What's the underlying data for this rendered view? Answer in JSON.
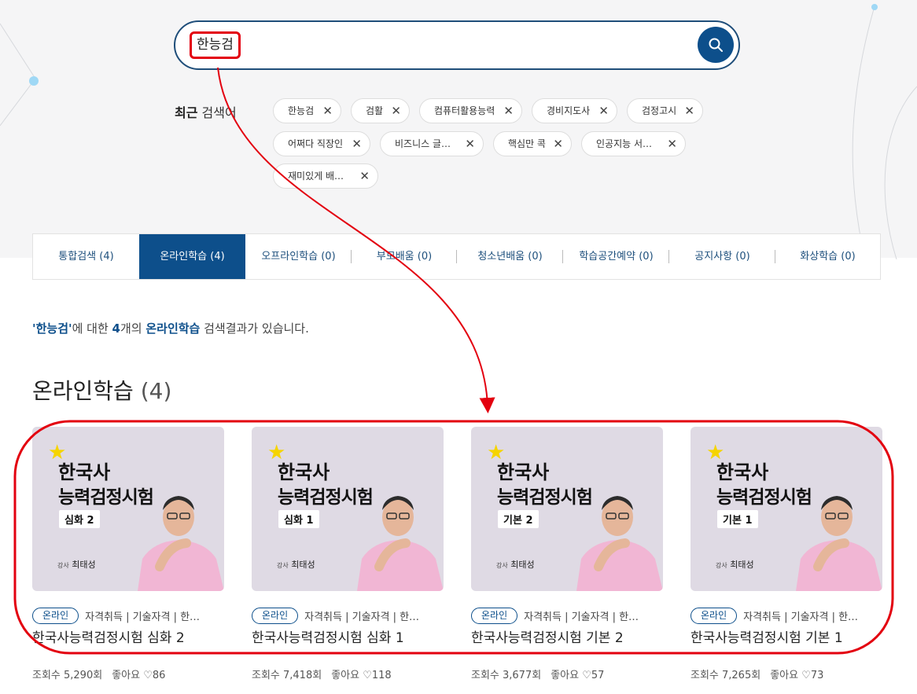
{
  "search": {
    "query": "한능검",
    "button_icon": "search-icon"
  },
  "recent": {
    "label_bold": "최근",
    "label_rest": " 검색어",
    "chips": [
      "한능검",
      "검활",
      "컴퓨터활용능력",
      "경비지도사",
      "검정고시",
      "어쩌다 직장인",
      "비즈니스 글…",
      "핵심만 콕",
      "인공지능 서…",
      "재미있게 배…"
    ]
  },
  "tabs": [
    {
      "label": "통합검색 (4)",
      "active": false
    },
    {
      "label": "온라인학습 (4)",
      "active": true
    },
    {
      "label": "오프라인학습 (0)",
      "active": false
    },
    {
      "label": "부모배움 (0)",
      "active": false
    },
    {
      "label": "청소년배움 (0)",
      "active": false
    },
    {
      "label": "학습공간예약 (0)",
      "active": false
    },
    {
      "label": "공지사항 (0)",
      "active": false
    },
    {
      "label": "화상학습 (0)",
      "active": false
    }
  ],
  "result": {
    "term": "'한능검'",
    "part1": "에 대한 ",
    "count": "4",
    "part2": "개의 ",
    "category": "온라인학습",
    "part3": " 검색결과가 있습니다."
  },
  "section": {
    "title": "온라인학습",
    "count": "(4)"
  },
  "cards": [
    {
      "thumb_line1": "한국사",
      "thumb_line2": "능력검정시험",
      "level": "심화 2",
      "teacher_prefix": "강사",
      "teacher": "최태성",
      "badge": "온라인",
      "tags": "자격취득 | 기술자격 | 한…",
      "title": "한국사능력검정시험 심화 2",
      "views": "조회수 5,290회",
      "likes": "좋아요 ♡86"
    },
    {
      "thumb_line1": "한국사",
      "thumb_line2": "능력검정시험",
      "level": "심화 1",
      "teacher_prefix": "강사",
      "teacher": "최태성",
      "badge": "온라인",
      "tags": "자격취득 | 기술자격 | 한…",
      "title": "한국사능력검정시험 심화 1",
      "views": "조회수 7,418회",
      "likes": "좋아요 ♡118"
    },
    {
      "thumb_line1": "한국사",
      "thumb_line2": "능력검정시험",
      "level": "기본 2",
      "teacher_prefix": "강사",
      "teacher": "최태성",
      "badge": "온라인",
      "tags": "자격취득 | 기술자격 | 한…",
      "title": "한국사능력검정시험 기본 2",
      "views": "조회수 3,677회",
      "likes": "좋아요 ♡57"
    },
    {
      "thumb_line1": "한국사",
      "thumb_line2": "능력검정시험",
      "level": "기본 1",
      "teacher_prefix": "강사",
      "teacher": "최태성",
      "badge": "온라인",
      "tags": "자격취득 | 기술자격 | 한…",
      "title": "한국사능력검정시험 기본 1",
      "views": "조회수 7,265회",
      "likes": "좋아요 ♡73"
    }
  ],
  "colors": {
    "accent": "#0d4f8b",
    "annotation": "#e3000f",
    "star": "#f5d400",
    "thumb_bg": "#dfdae4"
  }
}
